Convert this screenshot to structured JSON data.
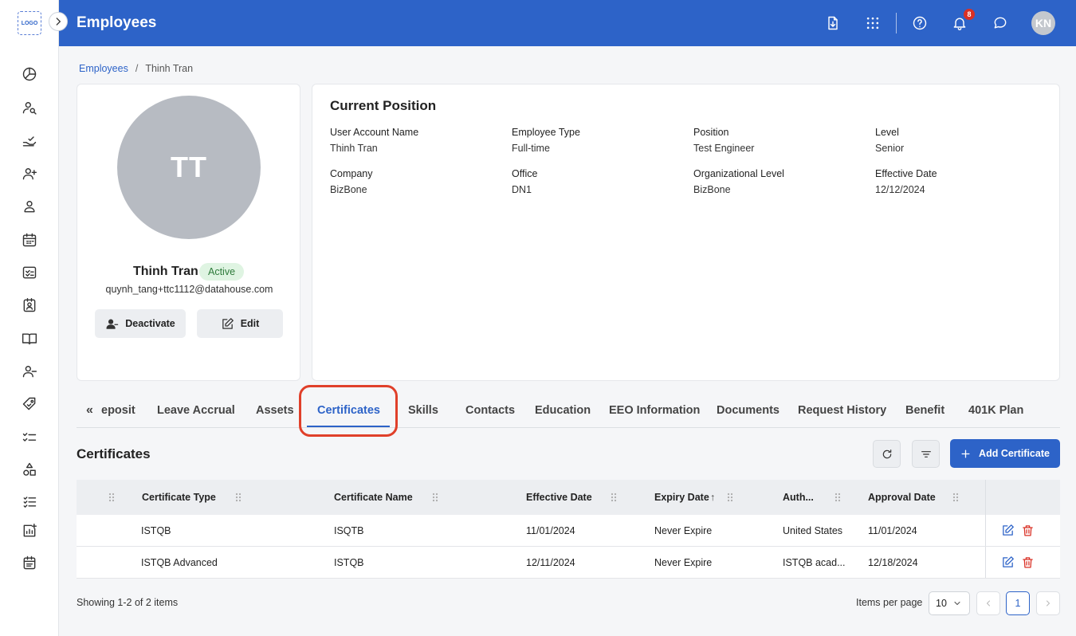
{
  "app": {
    "logo_text": "LOGO",
    "page_title": "Employees",
    "notification_count": "8",
    "user_initials": "KN"
  },
  "colors": {
    "brand": "#2d63c8",
    "status_active_bg": "#dff4e2",
    "status_active_text": "#2d7a3a",
    "delete": "#d93025",
    "highlight": "#e0402a"
  },
  "sidebar": {
    "icons": [
      "dashboard-icon",
      "people-search-icon",
      "hand-check-icon",
      "user-add-icon",
      "user-icon",
      "calendar-icon",
      "checklist-icon",
      "id-card-icon",
      "book-icon",
      "user-remove-icon",
      "tag-icon",
      "task-list-icon",
      "shapes-icon",
      "list-check-icon",
      "report-add-icon",
      "schedule-icon"
    ]
  },
  "header_icons": [
    "download-icon",
    "apps-grid-icon",
    "help-icon",
    "bell-icon",
    "chat-icon"
  ],
  "breadcrumb": {
    "parent": "Employees",
    "separator": "/",
    "current": "Thinh Tran"
  },
  "profile": {
    "initials": "TT",
    "name": "Thinh Tran",
    "status": "Active",
    "email": "quynh_tang+ttc1112@datahouse.com",
    "deactivate_label": "Deactivate",
    "edit_label": "Edit"
  },
  "position": {
    "title": "Current Position",
    "fields": [
      {
        "label": "User Account Name",
        "value": "Thinh Tran"
      },
      {
        "label": "Employee Type",
        "value": "Full-time"
      },
      {
        "label": "Position",
        "value": "Test Engineer"
      },
      {
        "label": "Level",
        "value": "Senior"
      },
      {
        "label": "Company",
        "value": "BizBone"
      },
      {
        "label": "Office",
        "value": "DN1"
      },
      {
        "label": "Organizational Level",
        "value": "BizBone"
      },
      {
        "label": "Effective Date",
        "value": "12/12/2024"
      }
    ]
  },
  "tabs": {
    "scroll_left_glyph": "«",
    "items": [
      "eposit",
      "Leave Accrual",
      "Assets",
      "Certificates",
      "Skills",
      "Contacts",
      "Education",
      "EEO Information",
      "Documents",
      "Request History",
      "Benefit",
      "401K Plan"
    ],
    "active": "Certificates"
  },
  "certificates": {
    "title": "Certificates",
    "add_label": "Add Certificate",
    "columns": [
      "Certificate Type",
      "Certificate Name",
      "Effective Date",
      "Expiry Date",
      "Auth...",
      "Approval Date"
    ],
    "sort_indicator": "↑",
    "rows": [
      {
        "type": "ISTQB",
        "name": "ISQTB",
        "effective": "11/01/2024",
        "expiry": "Never Expire",
        "auth": "United States",
        "approval": "11/01/2024"
      },
      {
        "type": "ISTQB Advanced",
        "name": "ISTQB",
        "effective": "12/11/2024",
        "expiry": "Never Expire",
        "auth": "ISTQB acad...",
        "approval": "12/18/2024"
      }
    ]
  },
  "pagination": {
    "showing": "Showing 1-2 of 2 items",
    "items_per_page_label": "Items per page",
    "items_per_page": "10",
    "current_page": "1"
  }
}
